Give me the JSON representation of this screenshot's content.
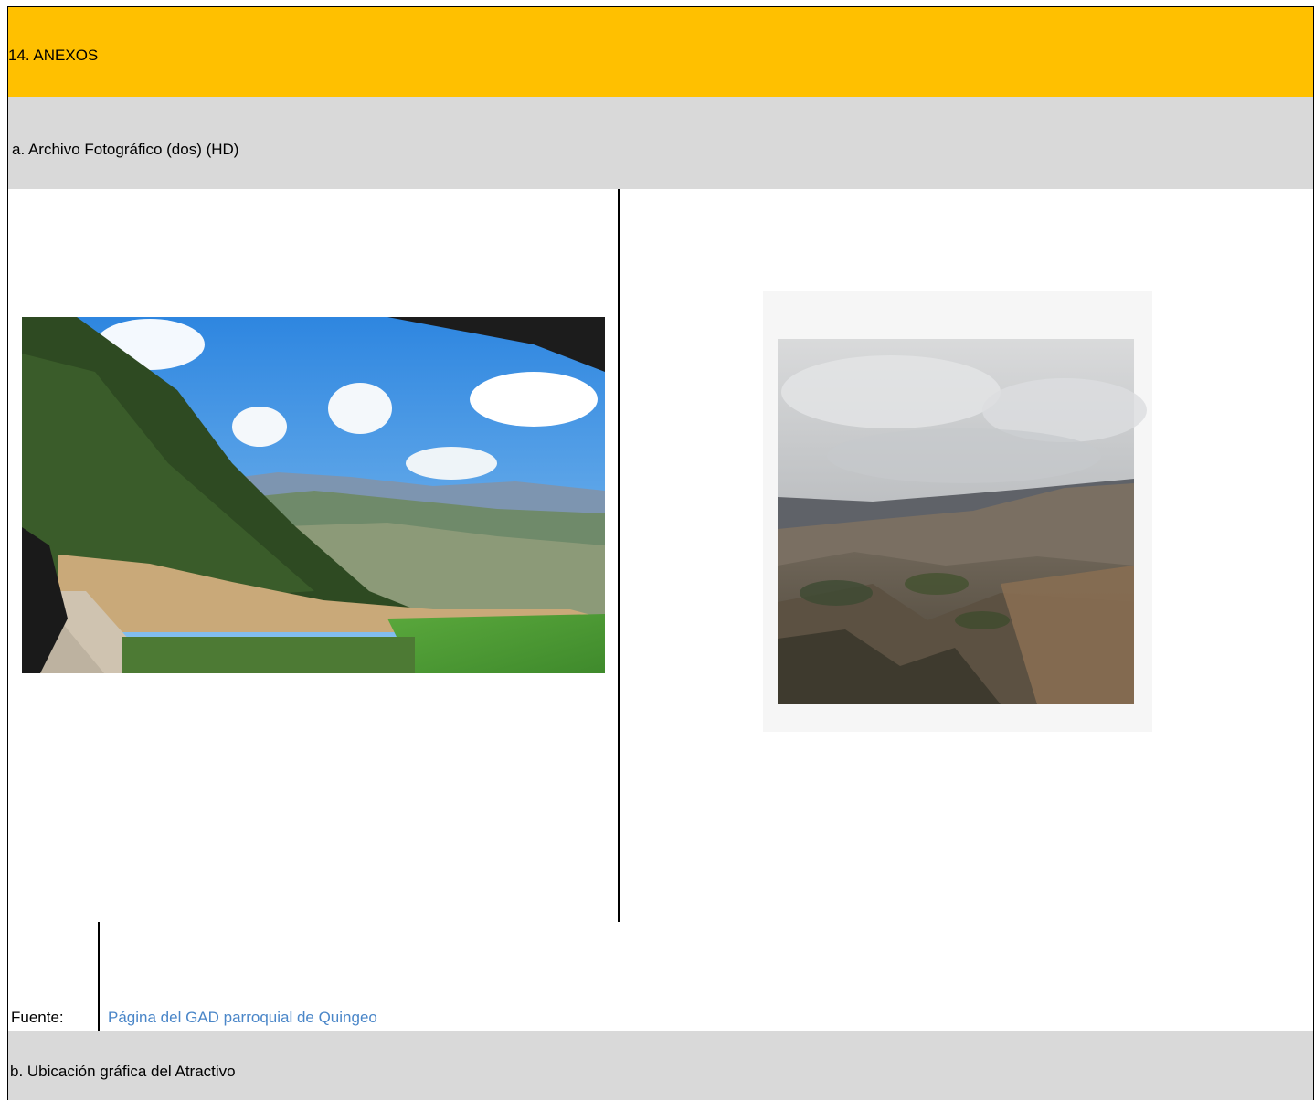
{
  "section": {
    "title": "14. ANEXOS",
    "subsection_a": "a. Archivo Fotográfico (dos) (HD)",
    "subsection_b": "b. Ubicación gráfica del Atractivo"
  },
  "photos": [
    {
      "name": "mountain-valley-road-photo"
    },
    {
      "name": "cloudy-highlands-photo"
    }
  ],
  "source": {
    "label": "Fuente:",
    "link_text": "Página del GAD parroquial de Quingeo"
  },
  "colors": {
    "header_bg": "#ffc000",
    "subheader_bg": "#d9d9d9",
    "link": "#4a86c8"
  }
}
